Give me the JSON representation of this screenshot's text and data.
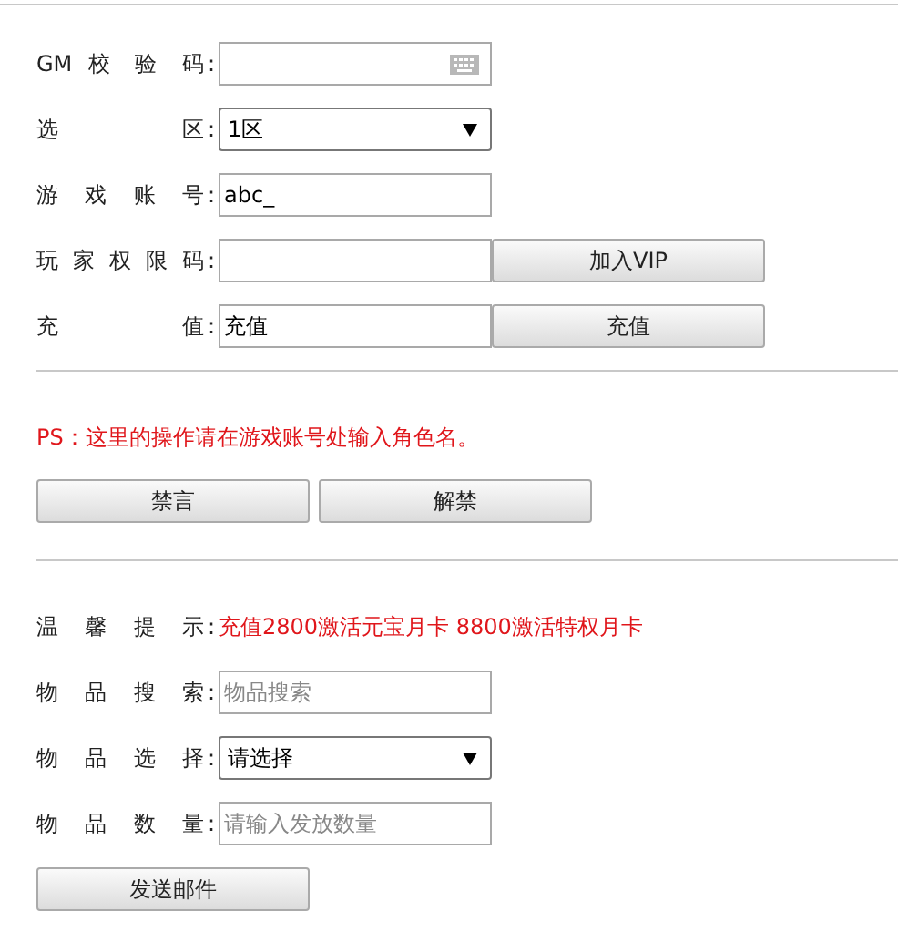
{
  "top_form": [
    {
      "label": "GM 校 验 码",
      "colon": ":",
      "kind": "secure"
    },
    {
      "label": "选 区",
      "colon": ":",
      "kind": "select",
      "value": "1区"
    },
    {
      "label": "游 戏 账 号",
      "colon": ":",
      "kind": "text",
      "value": "abc_"
    },
    {
      "label": "玩 家 权 限 码",
      "colon": ":",
      "kind": "text",
      "button": "加入VIP"
    },
    {
      "label": "充 值",
      "colon": ":",
      "kind": "text",
      "value": "充值",
      "button": "充值"
    }
  ],
  "note": "PS：这里的操作请在游戏账号处输入角色名。",
  "mute_buttons": [
    "禁言",
    "解禁"
  ],
  "tip": {
    "label": "温 馨 提 示",
    "colon": ":",
    "text": "充值2800激活元宝月卡 8800激活特权月卡"
  },
  "item_form": [
    {
      "label": "物 品 搜 索",
      "colon": ":",
      "kind": "text",
      "placeholder": "物品搜索"
    },
    {
      "label": "物 品 选 择",
      "colon": ":",
      "kind": "select",
      "value": "请选择"
    },
    {
      "label": "物 品 数 量",
      "colon": ":",
      "kind": "text",
      "placeholder": "请输入发放数量"
    }
  ],
  "send_button": "发送邮件"
}
